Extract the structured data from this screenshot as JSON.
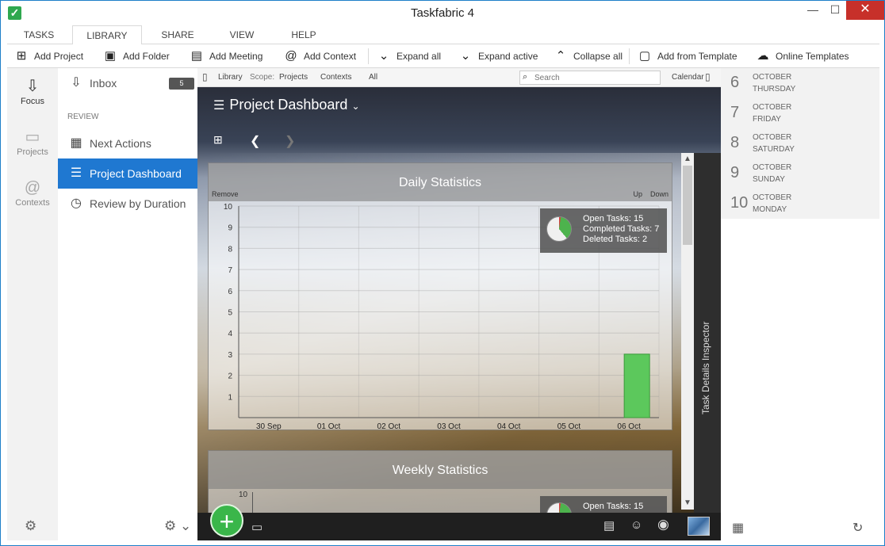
{
  "window": {
    "title": "Taskfabric 4",
    "min": "—",
    "max": "☐",
    "close": "✕"
  },
  "menu": {
    "tabs": [
      "TASKS",
      "LIBRARY",
      "SHARE",
      "VIEW",
      "HELP"
    ],
    "active": "LIBRARY"
  },
  "toolbar": {
    "add_project": "Add Project",
    "add_folder": "Add Folder",
    "add_meeting": "Add Meeting",
    "add_context": "Add Context",
    "expand_all": "Expand all",
    "expand_active": "Expand active",
    "collapse_all": "Collapse all",
    "add_from_template": "Add from Template",
    "online_templates": "Online Templates"
  },
  "rail": {
    "focus": "Focus",
    "projects": "Projects",
    "contexts": "Contexts"
  },
  "list": {
    "inbox": "Inbox",
    "inbox_count": "5",
    "section": "REVIEW",
    "next_actions": "Next Actions",
    "project_dashboard": "Project Dashboard",
    "review_by_duration": "Review by Duration"
  },
  "content_header": {
    "library": "Library",
    "scope": "Scope:",
    "projects": "Projects",
    "contexts": "Contexts",
    "all": "All",
    "search_placeholder": "Search",
    "calendar": "Calendar"
  },
  "dashboard": {
    "title": "Project Dashboard"
  },
  "daily": {
    "title": "Daily Statistics",
    "remove": "Remove",
    "up": "Up",
    "down": "Down",
    "open_tasks": "Open Tasks: 15",
    "completed_tasks": "Completed Tasks: 7",
    "deleted_tasks": "Deleted Tasks: 2"
  },
  "weekly": {
    "title": "Weekly Statistics",
    "open_tasks": "Open Tasks: 15",
    "y_top": "10"
  },
  "inspector": {
    "label": "Task Details Inspector"
  },
  "chart_data": {
    "type": "bar",
    "title": "Daily Statistics",
    "categories": [
      "30 Sep",
      "01 Oct",
      "02 Oct",
      "03 Oct",
      "04 Oct",
      "05 Oct",
      "06 Oct"
    ],
    "values": [
      0,
      0,
      0,
      0,
      0,
      0,
      3
    ],
    "ylim": [
      0,
      10
    ],
    "yticks": [
      1,
      2,
      3,
      4,
      5,
      6,
      7,
      8,
      9,
      10
    ],
    "color": "#5cc85c",
    "grid": true
  },
  "calendar": [
    {
      "num": "6",
      "month": "OCTOBER",
      "dow": "THURSDAY"
    },
    {
      "num": "7",
      "month": "OCTOBER",
      "dow": "FRIDAY"
    },
    {
      "num": "8",
      "month": "OCTOBER",
      "dow": "SATURDAY"
    },
    {
      "num": "9",
      "month": "OCTOBER",
      "dow": "SUNDAY"
    },
    {
      "num": "10",
      "month": "OCTOBER",
      "dow": "MONDAY"
    }
  ]
}
